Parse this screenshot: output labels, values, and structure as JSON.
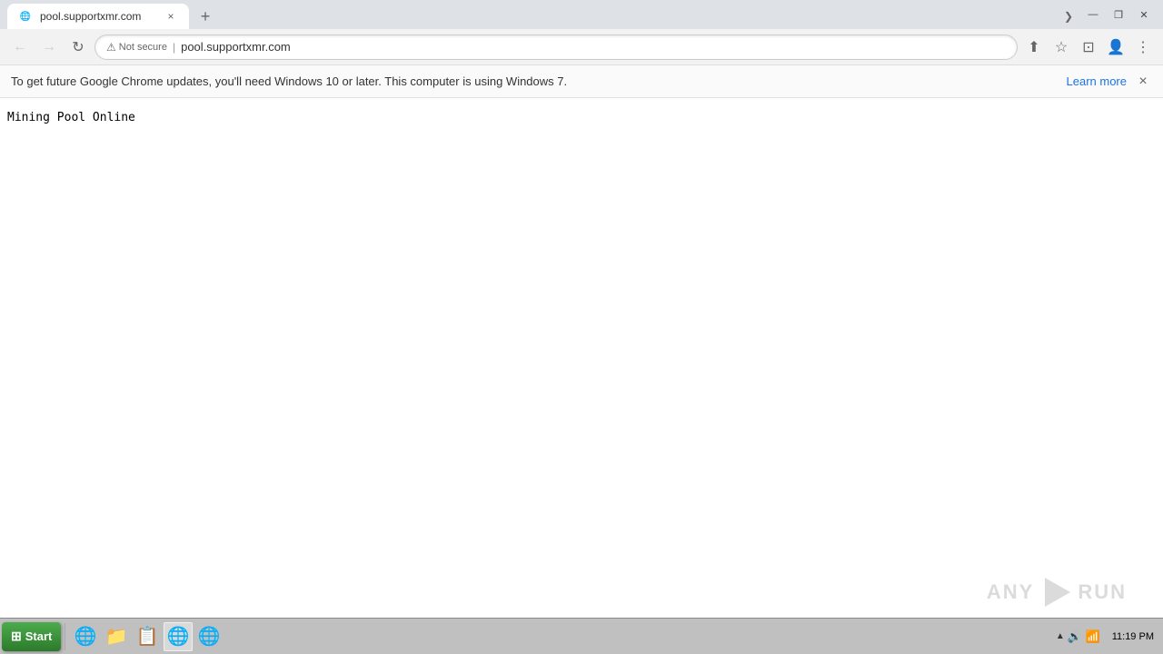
{
  "titlebar": {
    "tab": {
      "favicon": "🌐",
      "title": "pool.supportxmr.com",
      "close_label": "×"
    },
    "new_tab_label": "+",
    "scroll_label": "❯",
    "window_controls": {
      "minimize": "—",
      "maximize": "❐",
      "close": "✕"
    }
  },
  "navbar": {
    "back_label": "←",
    "forward_label": "→",
    "reload_label": "↻",
    "not_secure_label": "Not secure",
    "url": "pool.supportxmr.com",
    "share_label": "⬆",
    "bookmark_label": "☆",
    "media_label": "⊡",
    "profile_label": "👤",
    "menu_label": "⋮"
  },
  "infobar": {
    "message": "To get future Google Chrome updates, you'll need Windows 10 or later. This computer is using Windows 7.",
    "learn_more_label": "Learn more",
    "close_label": "×"
  },
  "page": {
    "content": "Mining Pool Online"
  },
  "taskbar": {
    "start_label": "Start",
    "apps": [
      {
        "icon": "🌐",
        "name": "Internet Explorer",
        "active": false
      },
      {
        "icon": "📁",
        "name": "File Explorer",
        "active": false
      },
      {
        "icon": "📋",
        "name": "Task Manager",
        "active": false
      },
      {
        "icon": "🌐",
        "name": "Chrome",
        "active": true
      },
      {
        "icon": "🌐",
        "name": "Edge",
        "active": false
      }
    ],
    "tray": {
      "expand_label": "▲",
      "volume_icon": "🔊",
      "network_icon": "📶",
      "clock": "11:19 PM"
    }
  },
  "watermark": {
    "text_left": "ANY",
    "text_right": "RUN"
  }
}
